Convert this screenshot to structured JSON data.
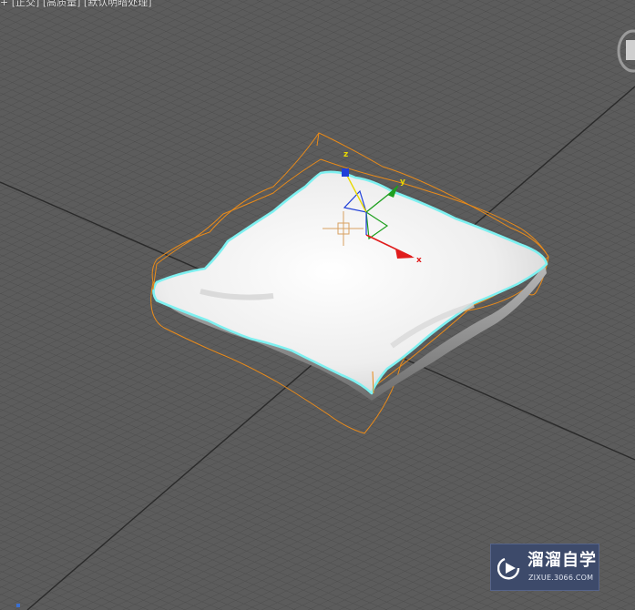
{
  "viewport": {
    "menu": {
      "plus": "+",
      "view": "[正交]",
      "quality": "[高质量]",
      "lighting": "[默认明暗处理]"
    },
    "colors": {
      "background": "#5a5a5a",
      "grid": "#4a4a4a",
      "selection_outline": "#7ef0f0",
      "bounding_box": "#e88a1a",
      "pillow": "#f4f4f4"
    }
  },
  "gizmo": {
    "x_label": "x",
    "y_label": "y",
    "z_label": "z",
    "colors": {
      "x": "#e01c1c",
      "y": "#1fa01f",
      "z": "#1f3fd8",
      "plane": "#e8d800"
    }
  },
  "viewcube": {
    "icon": "viewcube-icon"
  },
  "watermark": {
    "name": "溜溜自学",
    "url": "ZIXUE.3066.COM",
    "icon": "play-logo-icon"
  }
}
